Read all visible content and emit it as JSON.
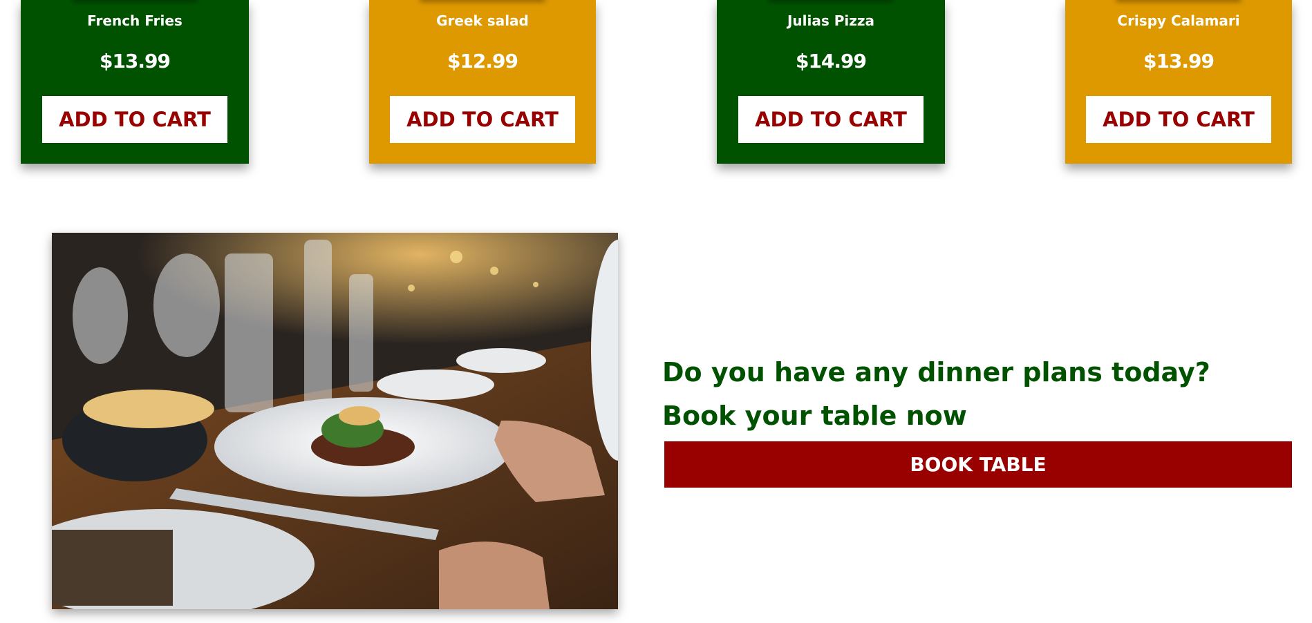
{
  "menu": {
    "items": [
      {
        "name": "French Fries",
        "price": "$13.99",
        "button": "ADD TO CART",
        "color": "#005200"
      },
      {
        "name": "Greek salad",
        "price": "$12.99",
        "button": "ADD TO CART",
        "color": "#de9800"
      },
      {
        "name": "Julias Pizza",
        "price": "$14.99",
        "button": "ADD TO CART",
        "color": "#005200"
      },
      {
        "name": "Crispy Calamari",
        "price": "$13.99",
        "button": "ADD TO CART",
        "color": "#de9800"
      }
    ]
  },
  "booking": {
    "headline": "Do you have any dinner plans today?",
    "subheadline": "Book your table now",
    "button": "BOOK TABLE"
  },
  "colors": {
    "green": "#005200",
    "orange": "#de9800",
    "red": "#990000"
  }
}
